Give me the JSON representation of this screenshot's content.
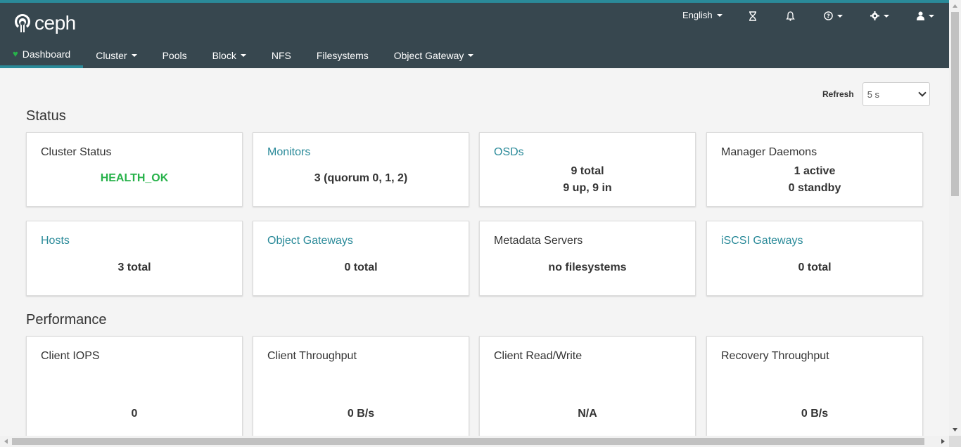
{
  "brand": {
    "name": "ceph"
  },
  "header": {
    "language": "English",
    "icons": [
      "hourglass-icon",
      "bell-icon",
      "help-icon",
      "gear-icon",
      "user-icon"
    ]
  },
  "nav": {
    "items": [
      {
        "label": "Dashboard",
        "active": true
      },
      {
        "label": "Cluster",
        "dropdown": true
      },
      {
        "label": "Pools"
      },
      {
        "label": "Block",
        "dropdown": true
      },
      {
        "label": "NFS"
      },
      {
        "label": "Filesystems"
      },
      {
        "label": "Object Gateway",
        "dropdown": true
      }
    ]
  },
  "refresh": {
    "label": "Refresh",
    "value": "5 s"
  },
  "status": {
    "title": "Status",
    "cards": [
      {
        "title": "Cluster Status",
        "link": false,
        "lines": [
          "HEALTH_OK"
        ],
        "health_color": "#27b24a"
      },
      {
        "title": "Monitors",
        "link": true,
        "lines": [
          "3 (quorum 0, 1, 2)"
        ]
      },
      {
        "title": "OSDs",
        "link": true,
        "lines": [
          "9 total",
          "9 up, 9 in"
        ]
      },
      {
        "title": "Manager Daemons",
        "link": false,
        "lines": [
          "1 active",
          "0 standby"
        ]
      },
      {
        "title": "Hosts",
        "link": true,
        "lines": [
          "3 total"
        ]
      },
      {
        "title": "Object Gateways",
        "link": true,
        "lines": [
          "0 total"
        ]
      },
      {
        "title": "Metadata Servers",
        "link": false,
        "lines": [
          "no filesystems"
        ]
      },
      {
        "title": "iSCSI Gateways",
        "link": true,
        "lines": [
          "0 total"
        ]
      }
    ]
  },
  "performance": {
    "title": "Performance",
    "cards": [
      {
        "title": "Client IOPS",
        "value": "0"
      },
      {
        "title": "Client Throughput",
        "value": "0 B/s"
      },
      {
        "title": "Client Read/Write",
        "value": "N/A"
      },
      {
        "title": "Recovery Throughput",
        "value": "0 B/s"
      }
    ]
  },
  "colors": {
    "header_bg": "#37474f",
    "accent": "#2a8a99",
    "ok": "#27b24a"
  }
}
